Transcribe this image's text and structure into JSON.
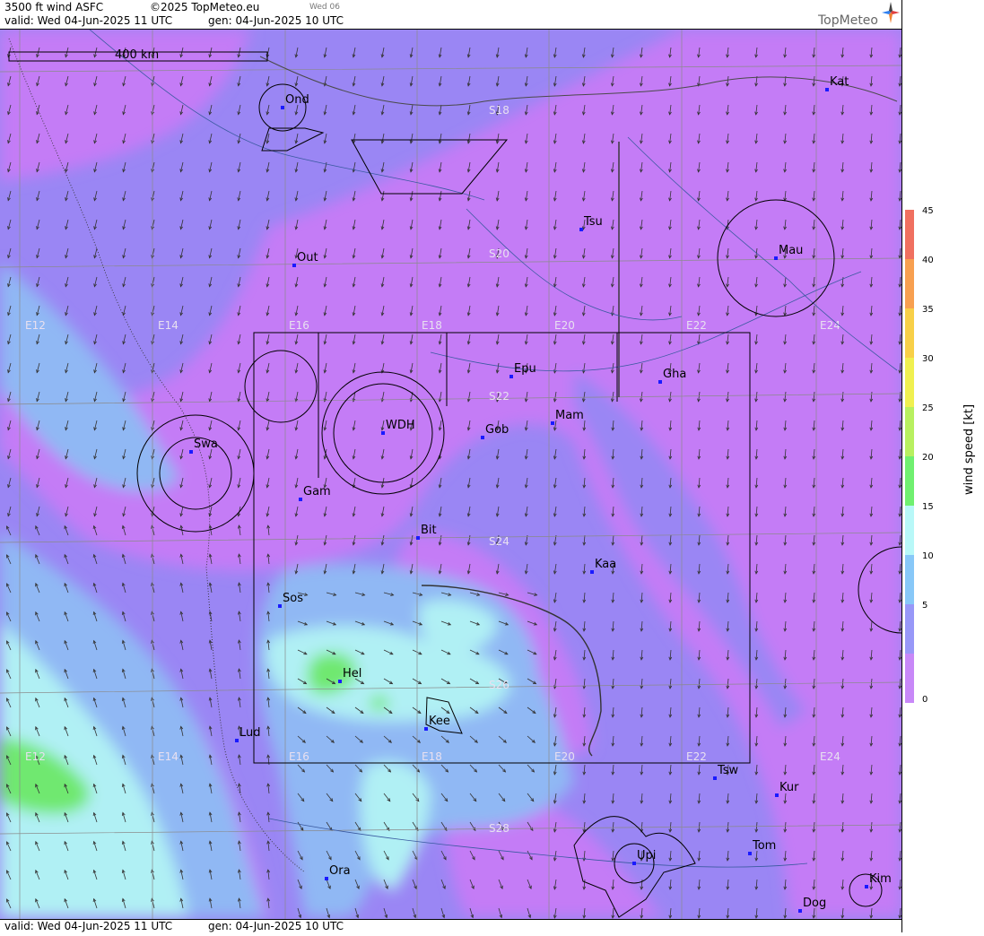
{
  "header": {
    "title": "3500 ft wind ASFC",
    "copyright": "©2025 TopMeteo.eu",
    "day_tag": "Wed 06",
    "valid": "valid:  Wed  04-Jun-2025  11 UTC",
    "generated": "gen: 04-Jun-2025 10 UTC",
    "brand": "TopMeteo"
  },
  "footer": {
    "valid": "valid:  Wed  04-Jun-2025  11 UTC",
    "generated": "gen: 04-Jun-2025 10 UTC"
  },
  "scale_bar": {
    "label": "400 km"
  },
  "grid_labels": {
    "lon": [
      "E12",
      "E14",
      "E16",
      "E18",
      "E20",
      "E22",
      "E24"
    ],
    "lat": [
      "S18",
      "S20",
      "S22",
      "S24",
      "S26",
      "S28"
    ]
  },
  "stations": [
    {
      "id": "Ond"
    },
    {
      "id": "Kat"
    },
    {
      "id": "Tsu"
    },
    {
      "id": "Mau"
    },
    {
      "id": "Out"
    },
    {
      "id": "Epu"
    },
    {
      "id": "Gha"
    },
    {
      "id": "Mam"
    },
    {
      "id": "WDH"
    },
    {
      "id": "Gob"
    },
    {
      "id": "Swa"
    },
    {
      "id": "Gam"
    },
    {
      "id": "Bit"
    },
    {
      "id": "Kaa"
    },
    {
      "id": "Sos"
    },
    {
      "id": "Hel"
    },
    {
      "id": "Kee"
    },
    {
      "id": "Lud"
    },
    {
      "id": "Tsw"
    },
    {
      "id": "Kur"
    },
    {
      "id": "Tom"
    },
    {
      "id": "Upi"
    },
    {
      "id": "Ora"
    },
    {
      "id": "Kim"
    },
    {
      "id": "Dog"
    }
  ],
  "legend": {
    "title": "wind speed [kt]",
    "ticks": [
      "45",
      "40",
      "35",
      "30",
      "25",
      "20",
      "15",
      "10",
      "5",
      "0"
    ],
    "colors": [
      "#f07060",
      "#f8a050",
      "#f8d048",
      "#f0f050",
      "#b8f060",
      "#70f070",
      "#b8f8f8",
      "#88c8f8",
      "#9898f8",
      "#c888f8"
    ]
  },
  "colors": {
    "very_low": "#c47cf6",
    "low": "#9a86f4",
    "mid": "#90b8f4",
    "high": "#b0f0f4",
    "peak": "#70e870"
  }
}
